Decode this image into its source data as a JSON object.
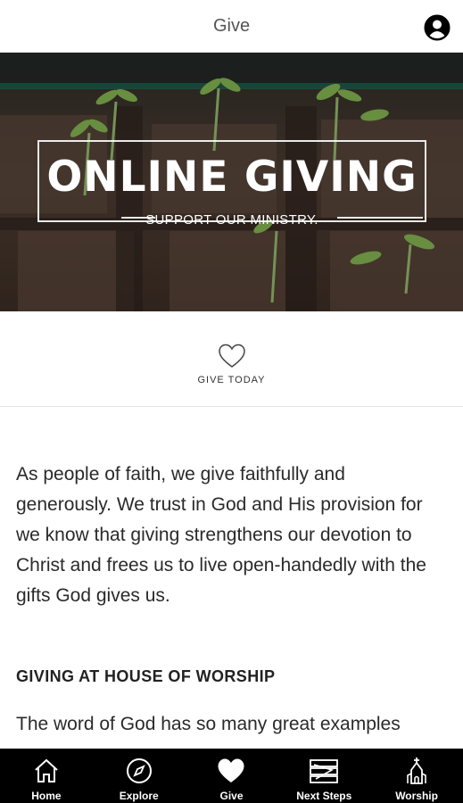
{
  "header": {
    "title": "Give",
    "profile_icon": "user-circle-icon"
  },
  "hero": {
    "title": "ONLINE GIVING",
    "subtitle": "SUPPORT OUR MINISTRY."
  },
  "give_today": {
    "label": "GIVE TODAY",
    "icon": "heart-outline-icon"
  },
  "body": {
    "paragraph": "As people of faith, we give faithfully and generously. We trust in God and His provision for we know that giving strengthens our devotion to Christ and frees us to live open-handedly with the gifts God gives us.",
    "section_heading": "GIVING AT HOUSE OF WORSHIP",
    "paragraph2": "The word of God has so many great examples"
  },
  "nav": {
    "items": [
      {
        "label": "Home",
        "icon": "home-icon"
      },
      {
        "label": "Explore",
        "icon": "compass-icon"
      },
      {
        "label": "Give",
        "icon": "heart-icon"
      },
      {
        "label": "Next Steps",
        "icon": "steps-icon"
      },
      {
        "label": "Worship",
        "icon": "church-icon"
      }
    ]
  },
  "colors": {
    "nav_bg": "#000000",
    "nav_text": "#ffffff",
    "hero_text": "#ffffff"
  }
}
